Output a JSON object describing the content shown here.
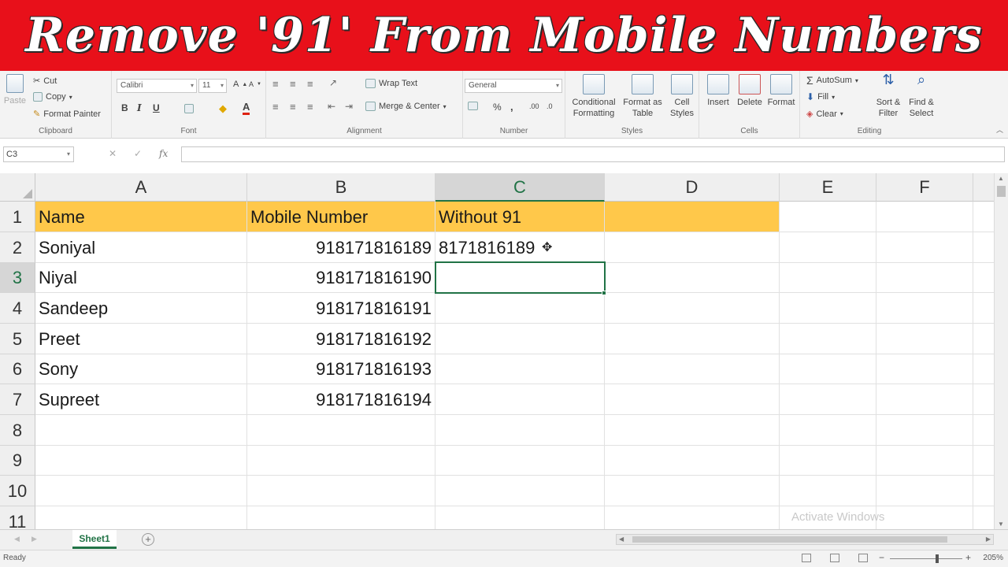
{
  "banner": {
    "title": "Remove '91' From Mobile Numbers"
  },
  "ribbon": {
    "clipboard": {
      "paste": "Paste",
      "cut": "Cut",
      "copy": "Copy",
      "format_painter": "Format Painter",
      "label": "Clipboard"
    },
    "font": {
      "name": "Calibri",
      "size": "11",
      "bold": "B",
      "italic": "I",
      "underline": "U",
      "label": "Font"
    },
    "alignment": {
      "wrap_text": "Wrap Text",
      "merge_center": "Merge & Center",
      "label": "Alignment"
    },
    "number": {
      "format": "General",
      "percent": "%",
      "comma": ",",
      "label": "Number"
    },
    "styles": {
      "conditional_formatting": "Conditional Formatting",
      "format_as_table": "Format as Table",
      "cell_styles": "Cell Styles",
      "label": "Styles"
    },
    "cells": {
      "insert": "Insert",
      "delete": "Delete",
      "format": "Format",
      "label": "Cells"
    },
    "editing": {
      "autosum": "AutoSum",
      "fill": "Fill",
      "clear": "Clear",
      "sort_filter": "Sort & Filter",
      "find_select": "Find & Select",
      "label": "Editing"
    }
  },
  "formula_bar": {
    "name_box": "C3",
    "fx": "fx",
    "value": ""
  },
  "grid": {
    "columns": [
      "A",
      "B",
      "C",
      "D",
      "E",
      "F"
    ],
    "active_column": "C",
    "rows": [
      "1",
      "2",
      "3",
      "4",
      "5",
      "6",
      "7",
      "8",
      "9",
      "10",
      "11"
    ],
    "active_row": "3",
    "header": {
      "name": "Name",
      "mobile": "Mobile Number",
      "without": "Without 91"
    },
    "data": [
      {
        "name": "Soniyal",
        "mobile": "918171816189",
        "without": "8171816189"
      },
      {
        "name": "Niyal",
        "mobile": "918171816190",
        "without": ""
      },
      {
        "name": "Sandeep",
        "mobile": "918171816191",
        "without": ""
      },
      {
        "name": "Preet",
        "mobile": "918171816192",
        "without": ""
      },
      {
        "name": "Sony",
        "mobile": "918171816193",
        "without": ""
      },
      {
        "name": "Supreet",
        "mobile": "918171816194",
        "without": ""
      }
    ],
    "selected_cell": "C3"
  },
  "sheet_tabs": {
    "active": "Sheet1",
    "add": "+"
  },
  "watermark": {
    "text": "Activate Windows"
  },
  "status": {
    "text": "Ready",
    "zoom": "205%"
  },
  "colors": {
    "banner": "#e8101a",
    "header_fill": "#ffc84a",
    "excel_green": "#217346"
  }
}
